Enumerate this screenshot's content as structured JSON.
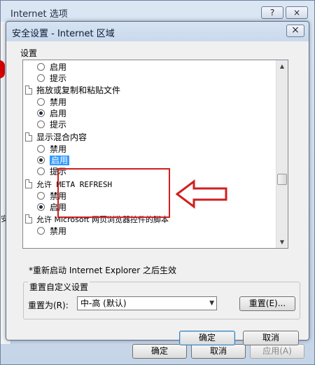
{
  "outer_window": {
    "title": "Internet 选项",
    "help_button": "?",
    "close_button": "×",
    "buttons": {
      "ok": "确定",
      "cancel": "取消",
      "apply": "应用(A)"
    },
    "left_char": "安"
  },
  "dialog": {
    "title": "安全设置 - Internet 区域",
    "close_button": "×",
    "settings_label": "设置",
    "items": [
      {
        "type": "radio",
        "label": "启用",
        "selected": false
      },
      {
        "type": "radio",
        "label": "提示",
        "selected": false
      },
      {
        "type": "header",
        "label": "拖放或复制和粘贴文件"
      },
      {
        "type": "radio",
        "label": "禁用",
        "selected": false
      },
      {
        "type": "radio",
        "label": "启用",
        "selected": true
      },
      {
        "type": "radio",
        "label": "提示",
        "selected": false
      },
      {
        "type": "header",
        "label": "显示混合内容"
      },
      {
        "type": "radio",
        "label": "禁用",
        "selected": false
      },
      {
        "type": "radio",
        "label": "启用",
        "selected": true,
        "highlighted": true
      },
      {
        "type": "radio",
        "label": "提示",
        "selected": false
      },
      {
        "type": "header",
        "label": "允许 META REFRESH"
      },
      {
        "type": "radio",
        "label": "禁用",
        "selected": false
      },
      {
        "type": "radio",
        "label": "启用",
        "selected": true
      },
      {
        "type": "header",
        "label": "允许 Microsoft 网页浏览器控件的脚本"
      },
      {
        "type": "radio",
        "label": "禁用",
        "selected": false
      }
    ],
    "restart_note": "*重新启动 Internet Explorer 之后生效",
    "reset": {
      "group_title": "重置自定义设置",
      "label": "重置为(R):",
      "selected": "中-高 (默认)",
      "button": "重置(E)..."
    },
    "ok": "确定",
    "cancel": "取消"
  },
  "colors": {
    "highlight": "#3399ff",
    "annotation": "#d01f1f"
  }
}
